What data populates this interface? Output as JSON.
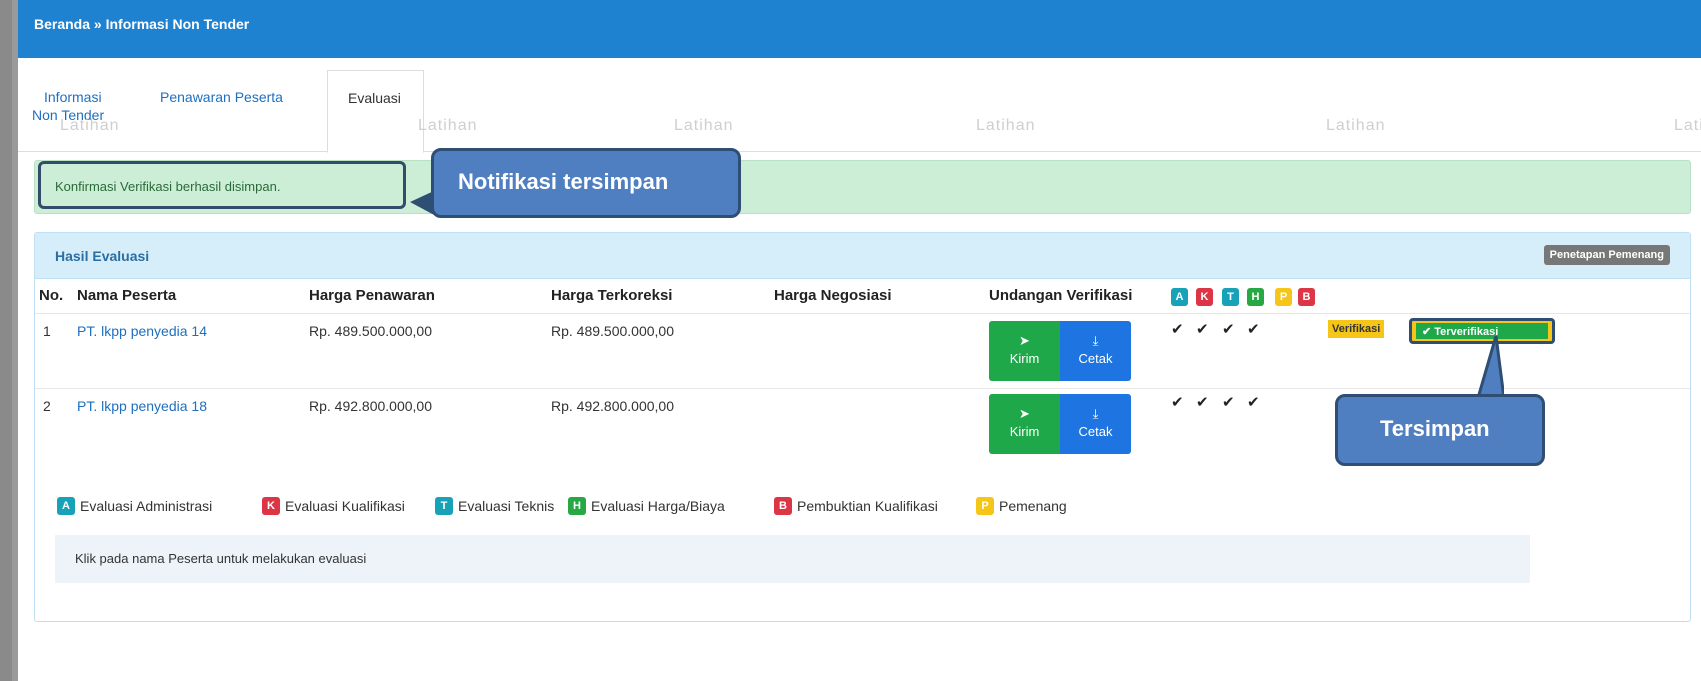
{
  "breadcrumb": "Beranda » Informasi Non Tender",
  "tabs": {
    "info_line1": "Informasi",
    "info_line2": "Non Tender",
    "penawaran": "Penawaran Peserta",
    "evaluasi": "Evaluasi"
  },
  "watermark": "Latihan",
  "alert": {
    "text": "Konfirmasi Verifikasi berhasil disimpan."
  },
  "callouts": {
    "notifikasi": "Notifikasi tersimpan",
    "tersimpan": "Tersimpan"
  },
  "panel": {
    "title": "Hasil Evaluasi",
    "winner_button": "Penetapan Pemenang",
    "columns": [
      "No.",
      "Nama Peserta",
      "Harga Penawaran",
      "Harga Terkoreksi",
      "Harga Negosiasi",
      "Undangan Verifikasi"
    ],
    "rows": [
      {
        "no": "1",
        "name": "PT. lkpp penyedia 14",
        "harga_penawaran": "Rp. 489.500.000,00",
        "harga_terkoreksi": "Rp. 489.500.000,00",
        "harga_negosiasi": ""
      },
      {
        "no": "2",
        "name": "PT. lkpp penyedia 18",
        "harga_penawaran": "Rp. 492.800.000,00",
        "harga_terkoreksi": "Rp. 492.800.000,00",
        "harga_negosiasi": ""
      }
    ],
    "kirim_label": "Kirim",
    "cetak_label": "Cetak",
    "check_glyph": "✔",
    "verifikasi_label": "Verifikasi",
    "terverifikasi_label": "✔ Terverifikasi"
  },
  "badges": [
    {
      "letter": "A",
      "label": "Evaluasi Administrasi",
      "color": "#17a2b8"
    },
    {
      "letter": "K",
      "label": "Evaluasi Kualifikasi",
      "color": "#dc3545"
    },
    {
      "letter": "T",
      "label": "Evaluasi Teknis",
      "color": "#17a2b8"
    },
    {
      "letter": "H",
      "label": "Evaluasi Harga/Biaya",
      "color": "#28a745"
    },
    {
      "letter": "P",
      "label": "Pemenang",
      "color": "#f5c518"
    },
    {
      "letter": "B",
      "label": "Pembuktian Kualifikasi",
      "color": "#dc3545"
    }
  ],
  "hint": "Klik pada nama Peserta untuk melakukan evaluasi"
}
